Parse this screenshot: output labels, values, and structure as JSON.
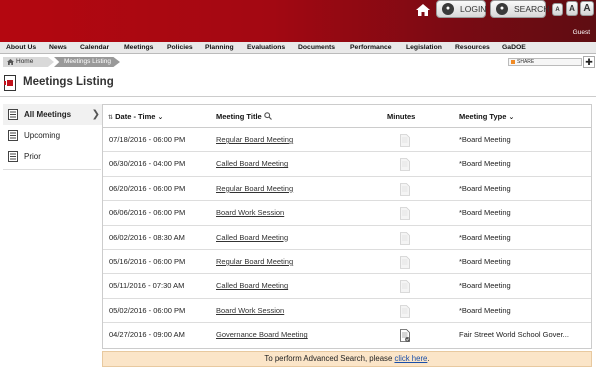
{
  "header": {
    "login_label": "LOGIN",
    "search_label": "SEARCH",
    "font_small": "A",
    "font_medium": "A",
    "font_large": "A",
    "guest_label": "Guest"
  },
  "nav": {
    "items": [
      "About Us",
      "News",
      "Calendar",
      "Meetings",
      "Policies",
      "Planning",
      "Evaluations",
      "Documents",
      "Performance",
      "Legislation",
      "Resources",
      "GaDOE"
    ]
  },
  "breadcrumb": {
    "home": "Home",
    "current": "Meetings Listing"
  },
  "share": {
    "label": "SHARE"
  },
  "page": {
    "title": "Meetings Listing"
  },
  "sidebar": {
    "items": [
      {
        "label": "All Meetings",
        "active": true
      },
      {
        "label": "Upcoming",
        "active": false
      },
      {
        "label": "Prior",
        "active": false
      }
    ]
  },
  "table": {
    "columns": {
      "date": "Date - Time",
      "title": "Meeting Title",
      "minutes": "Minutes",
      "type": "Meeting Type"
    },
    "rows": [
      {
        "date": "07/18/2016 - 06:00 PM",
        "title": "Regular Board Meeting",
        "type": "*Board Meeting",
        "minutes_icon": "document-icon"
      },
      {
        "date": "06/30/2016 - 04:00 PM",
        "title": "Called Board Meeting",
        "type": "*Board Meeting",
        "minutes_icon": "document-icon"
      },
      {
        "date": "06/20/2016 - 06:00 PM",
        "title": "Regular Board Meeting",
        "type": "*Board Meeting",
        "minutes_icon": "document-icon"
      },
      {
        "date": "06/06/2016 - 06:00 PM",
        "title": "Board Work Session",
        "type": "*Board Meeting",
        "minutes_icon": "document-icon"
      },
      {
        "date": "06/02/2016 - 08:30 AM",
        "title": "Called Board Meeting",
        "type": "*Board Meeting",
        "minutes_icon": "document-icon"
      },
      {
        "date": "05/16/2016 - 06:00 PM",
        "title": "Regular Board Meeting",
        "type": "*Board Meeting",
        "minutes_icon": "document-icon"
      },
      {
        "date": "05/11/2016 - 07:30 AM",
        "title": "Called Board Meeting",
        "type": "*Board Meeting",
        "minutes_icon": "document-icon"
      },
      {
        "date": "05/02/2016 - 06:00 PM",
        "title": "Board Work Session",
        "type": "*Board Meeting",
        "minutes_icon": "document-icon"
      },
      {
        "date": "04/27/2016 - 09:00 AM",
        "title": "Governance Board Meeting",
        "type": "Fair Street World School Gover...",
        "minutes_icon": "document-approved-icon"
      }
    ]
  },
  "footer": {
    "text": "To perform Advanced Search, please ",
    "link": "click here",
    "suffix": "."
  },
  "colors": {
    "banner": "#a30812",
    "banner_dark": "#5e0d12",
    "note_bg": "#fbe5c8",
    "link": "#1a4fa8"
  }
}
